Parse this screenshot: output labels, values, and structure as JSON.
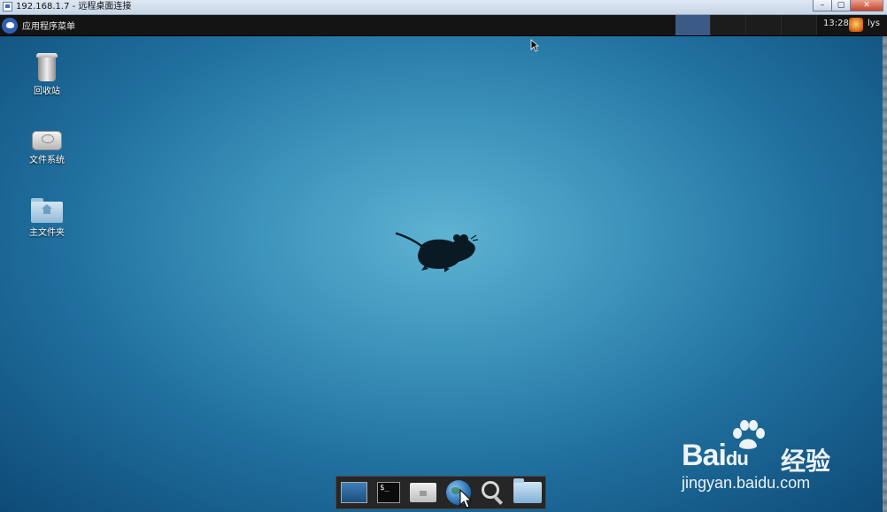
{
  "rdp_window": {
    "title": "192.168.1.7 - 远程桌面连接",
    "minimize": "–",
    "restore": "▢",
    "close": "✕"
  },
  "panel": {
    "menu_label": "应用程序菜单",
    "clock": "13:28",
    "username": "lys",
    "workspaces": 4,
    "active_workspace": 1
  },
  "desktop": {
    "icons": [
      {
        "label": "回收站",
        "icon": "trash-icon"
      },
      {
        "label": "文件系统",
        "icon": "drive-icon"
      },
      {
        "label": "主文件夹",
        "icon": "home-folder-icon"
      }
    ]
  },
  "dock": {
    "items": [
      "show-desktop-icon",
      "terminal-icon",
      "home-icon",
      "web-browser-icon",
      "app-finder-icon",
      "file-manager-icon"
    ],
    "terminal_text": "$_"
  },
  "watermark": {
    "brand": "Bai",
    "brand_suffix": "du",
    "cn": "经验",
    "url": "jingyan.baidu.com"
  },
  "colors": {
    "panel_bg": "#141414",
    "desktop_center": "#5eb3d2",
    "desktop_edge": "#0e4a77",
    "active_workspace": "#3b5a86"
  }
}
